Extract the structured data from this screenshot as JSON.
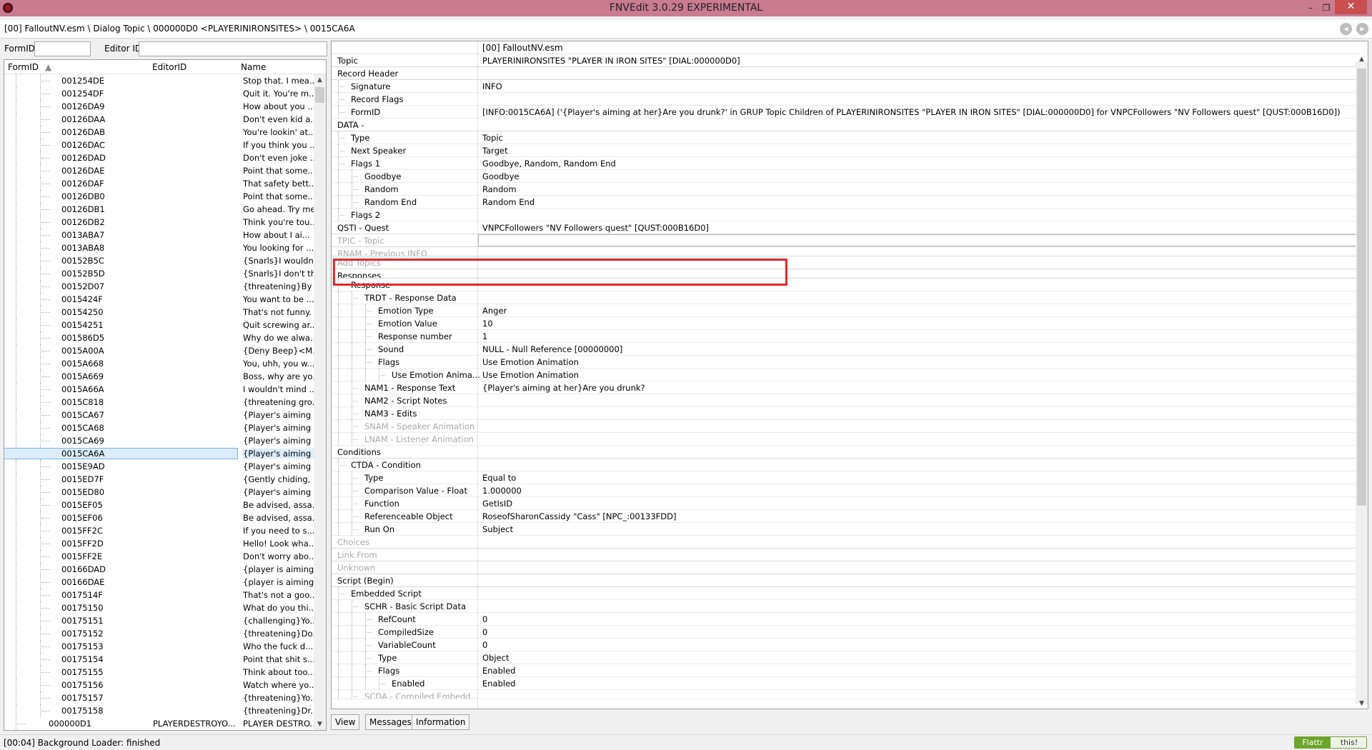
{
  "window": {
    "title": "FNVEdit 3.0.29 EXPERIMENTAL",
    "minimize": "–",
    "maximize": "❐",
    "close": "✕"
  },
  "path": {
    "text": "[00] FalloutNV.esm \\ Dialog Topic \\ 000000D0 <PLAYERINIRONSITES> \\ 0015CA6A",
    "back_icon": "◂",
    "forward_icon": "▸"
  },
  "filter": {
    "formid_label": "FormID",
    "editorid_label": "Editor ID",
    "formid_value": "",
    "editorid_value": ""
  },
  "tree": {
    "col_formid": "FormID",
    "col_editorid": "EditorID",
    "col_name": "Name",
    "rows": [
      {
        "fid": "001254DE",
        "editor": "",
        "name": "Stop that. I mea...",
        "indent": 2
      },
      {
        "fid": "001254DF",
        "editor": "",
        "name": "Quit it. You're m...",
        "indent": 2
      },
      {
        "fid": "00126DA9",
        "editor": "",
        "name": "How about you ...",
        "indent": 2
      },
      {
        "fid": "00126DAA",
        "editor": "",
        "name": "Don't even kid a...",
        "indent": 2
      },
      {
        "fid": "00126DAB",
        "editor": "",
        "name": "You're lookin' at...",
        "indent": 2
      },
      {
        "fid": "00126DAC",
        "editor": "",
        "name": "If you think you ...",
        "indent": 2
      },
      {
        "fid": "00126DAD",
        "editor": "",
        "name": "Don't even joke ...",
        "indent": 2
      },
      {
        "fid": "00126DAE",
        "editor": "",
        "name": "Point that some...",
        "indent": 2
      },
      {
        "fid": "00126DAF",
        "editor": "",
        "name": "That safety bett...",
        "indent": 2
      },
      {
        "fid": "00126DB0",
        "editor": "",
        "name": "Point that some...",
        "indent": 2
      },
      {
        "fid": "00126DB1",
        "editor": "",
        "name": "Go ahead. Try me.",
        "indent": 2
      },
      {
        "fid": "00126DB2",
        "editor": "",
        "name": "Think you're tou...",
        "indent": 2
      },
      {
        "fid": "0013ABA7",
        "editor": "",
        "name": "How about I ai...",
        "indent": 2
      },
      {
        "fid": "0013ABA8",
        "editor": "",
        "name": "You looking for ...",
        "indent": 2
      },
      {
        "fid": "00152B5C",
        "editor": "",
        "name": "{Snarls}I wouldn't.",
        "indent": 2
      },
      {
        "fid": "00152B5D",
        "editor": "",
        "name": "{Snarls}I don't th...",
        "indent": 2
      },
      {
        "fid": "00152D07",
        "editor": "",
        "name": "{threatening}By ...",
        "indent": 2
      },
      {
        "fid": "0015424F",
        "editor": "",
        "name": "You want to be ...",
        "indent": 2
      },
      {
        "fid": "00154250",
        "editor": "",
        "name": "That's not funny.",
        "indent": 2
      },
      {
        "fid": "00154251",
        "editor": "",
        "name": "Quit screwing ar...",
        "indent": 2
      },
      {
        "fid": "001586D5",
        "editor": "",
        "name": "Why do we alwa...",
        "indent": 2
      },
      {
        "fid": "0015A00A",
        "editor": "",
        "name": "{Deny Beep}<M...",
        "indent": 2
      },
      {
        "fid": "0015A668",
        "editor": "",
        "name": "You, uhh, you w...",
        "indent": 2
      },
      {
        "fid": "0015A669",
        "editor": "",
        "name": "Boss, why are yo...",
        "indent": 2
      },
      {
        "fid": "0015A66A",
        "editor": "",
        "name": "I wouldn't mind ...",
        "indent": 2
      },
      {
        "fid": "0015C818",
        "editor": "",
        "name": "{threatening gro...",
        "indent": 2
      },
      {
        "fid": "0015CA67",
        "editor": "",
        "name": "{Player's aiming ...",
        "indent": 2
      },
      {
        "fid": "0015CA68",
        "editor": "",
        "name": "{Player's aiming ...",
        "indent": 2
      },
      {
        "fid": "0015CA69",
        "editor": "",
        "name": "{Player's aiming ...",
        "indent": 2
      },
      {
        "fid": "0015CA6A",
        "editor": "",
        "name": "{Player's aiming ...",
        "indent": 2,
        "selected": true
      },
      {
        "fid": "0015E9AD",
        "editor": "",
        "name": "{Player's aiming ...",
        "indent": 2
      },
      {
        "fid": "0015ED7F",
        "editor": "",
        "name": "{Gently chiding, ...",
        "indent": 2
      },
      {
        "fid": "0015ED80",
        "editor": "",
        "name": "{Player's aiming ...",
        "indent": 2
      },
      {
        "fid": "0015EF05",
        "editor": "",
        "name": "Be advised, assa...",
        "indent": 2
      },
      {
        "fid": "0015EF06",
        "editor": "",
        "name": "Be advised, assa...",
        "indent": 2
      },
      {
        "fid": "0015FF2C",
        "editor": "",
        "name": "If you need to s...",
        "indent": 2
      },
      {
        "fid": "0015FF2D",
        "editor": "",
        "name": "Hello! Look wha...",
        "indent": 2
      },
      {
        "fid": "0015FF2E",
        "editor": "",
        "name": "Don't worry abo...",
        "indent": 2
      },
      {
        "fid": "00166DAD",
        "editor": "",
        "name": "{player is aiming...",
        "indent": 2
      },
      {
        "fid": "00166DAE",
        "editor": "",
        "name": "{player is aiming...",
        "indent": 2
      },
      {
        "fid": "0017514F",
        "editor": "",
        "name": "That's not a goo...",
        "indent": 2
      },
      {
        "fid": "00175150",
        "editor": "",
        "name": "What do you thi...",
        "indent": 2
      },
      {
        "fid": "00175151",
        "editor": "",
        "name": "{challenging}Yo...",
        "indent": 2
      },
      {
        "fid": "00175152",
        "editor": "",
        "name": "{threatening}Do...",
        "indent": 2
      },
      {
        "fid": "00175153",
        "editor": "",
        "name": "Who the fuck d...",
        "indent": 2
      },
      {
        "fid": "00175154",
        "editor": "",
        "name": "Point that shit s...",
        "indent": 2
      },
      {
        "fid": "00175155",
        "editor": "",
        "name": "Think about too...",
        "indent": 2
      },
      {
        "fid": "00175156",
        "editor": "",
        "name": "Watch where yo...",
        "indent": 2
      },
      {
        "fid": "00175157",
        "editor": "",
        "name": "{threatening}Yo...",
        "indent": 2
      },
      {
        "fid": "00175158",
        "editor": "",
        "name": "{threatening}Dr...",
        "indent": 2
      },
      {
        "fid": "000000D1",
        "editor": "PLAYERDESTROYO...",
        "name": "PLAYER DESTRO...",
        "indent": 1
      }
    ]
  },
  "records": {
    "header_value": "[00] FalloutNV.esm",
    "rows": [
      {
        "k": "Topic",
        "v": "PLAYERINIRONSITES \"PLAYER IN IRON SITES\" [DIAL:000000D0]",
        "d": 0
      },
      {
        "k": "Record Header",
        "v": "",
        "d": 0
      },
      {
        "k": "Signature",
        "v": "INFO",
        "d": 1
      },
      {
        "k": "Record Flags",
        "v": "",
        "d": 1
      },
      {
        "k": "FormID",
        "v": "[INFO:0015CA6A] ('{Player's aiming at her}Are you drunk?' in GRUP Topic Children of PLAYERINIRONSITES \"PLAYER IN IRON SITES\" [DIAL:000000D0] for VNPCFollowers \"NV Followers quest\" [QUST:000B16D0])",
        "d": 1
      },
      {
        "k": "DATA -",
        "v": "",
        "d": 0
      },
      {
        "k": "Type",
        "v": "Topic",
        "d": 1
      },
      {
        "k": "Next Speaker",
        "v": "Target",
        "d": 1
      },
      {
        "k": "Flags 1",
        "v": "Goodbye, Random, Random End",
        "d": 1
      },
      {
        "k": "Goodbye",
        "v": "Goodbye",
        "d": 2
      },
      {
        "k": "Random",
        "v": "Random",
        "d": 2
      },
      {
        "k": "Random End",
        "v": "Random End",
        "d": 2
      },
      {
        "k": "Flags 2",
        "v": "",
        "d": 1
      },
      {
        "k": "QSTI - Quest",
        "v": "VNPCFollowers \"NV Followers quest\" [QUST:000B16D0]",
        "d": 0
      },
      {
        "k": "TPIC - Topic",
        "v": "",
        "d": 0,
        "disabled": true,
        "editing": true
      },
      {
        "k": "RNAM - Previous INFO",
        "v": "",
        "d": 0,
        "disabled": true,
        "clipped": true
      },
      {
        "k": "Add Topics",
        "v": "",
        "d": 0,
        "disabled": true
      },
      {
        "k": "Responses",
        "v": "",
        "d": 0,
        "clipped": true
      },
      {
        "k": "Response",
        "v": "",
        "d": 1
      },
      {
        "k": "TRDT - Response Data",
        "v": "",
        "d": 2
      },
      {
        "k": "Emotion Type",
        "v": "Anger",
        "d": 3
      },
      {
        "k": "Emotion Value",
        "v": "10",
        "d": 3
      },
      {
        "k": "Response number",
        "v": "1",
        "d": 3
      },
      {
        "k": "Sound",
        "v": "NULL - Null Reference [00000000]",
        "d": 3
      },
      {
        "k": "Flags",
        "v": "Use Emotion Animation",
        "d": 3
      },
      {
        "k": "Use Emotion Anima...",
        "v": "Use Emotion Animation",
        "d": 4
      },
      {
        "k": "NAM1 - Response Text",
        "v": "{Player's aiming at her}Are you drunk?",
        "d": 2
      },
      {
        "k": "NAM2 - Script Notes",
        "v": "",
        "d": 2
      },
      {
        "k": "NAM3 - Edits",
        "v": "",
        "d": 2
      },
      {
        "k": "SNAM - Speaker Animation",
        "v": "",
        "d": 2,
        "disabled": true
      },
      {
        "k": "LNAM - Listener Animation",
        "v": "",
        "d": 2,
        "disabled": true
      },
      {
        "k": "Conditions",
        "v": "",
        "d": 0
      },
      {
        "k": "CTDA - Condition",
        "v": "",
        "d": 1
      },
      {
        "k": "Type",
        "v": "Equal to",
        "d": 2
      },
      {
        "k": "Comparison Value - Float",
        "v": "1.000000",
        "d": 2
      },
      {
        "k": "Function",
        "v": "GetIsID",
        "d": 2
      },
      {
        "k": "Referenceable Object",
        "v": "RoseofSharonCassidy \"Cass\" [NPC_:00133FDD]",
        "d": 2
      },
      {
        "k": "Run On",
        "v": "Subject",
        "d": 2
      },
      {
        "k": "Choices",
        "v": "",
        "d": 0,
        "disabled": true
      },
      {
        "k": "Link From",
        "v": "",
        "d": 0,
        "disabled": true
      },
      {
        "k": "Unknown",
        "v": "",
        "d": 0,
        "disabled": true
      },
      {
        "k": "Script (Begin)",
        "v": "",
        "d": 0
      },
      {
        "k": "Embedded Script",
        "v": "",
        "d": 1
      },
      {
        "k": "SCHR - Basic Script Data",
        "v": "",
        "d": 2
      },
      {
        "k": "RefCount",
        "v": "0",
        "d": 3
      },
      {
        "k": "CompiledSize",
        "v": "0",
        "d": 3
      },
      {
        "k": "VariableCount",
        "v": "0",
        "d": 3
      },
      {
        "k": "Type",
        "v": "Object",
        "d": 3
      },
      {
        "k": "Flags",
        "v": "Enabled",
        "d": 3
      },
      {
        "k": "Enabled",
        "v": "Enabled",
        "d": 4
      },
      {
        "k": "SCDA - Compiled Embedd...",
        "v": "",
        "d": 2,
        "disabled": true,
        "clipped": true
      }
    ]
  },
  "tabs": [
    {
      "label": "View",
      "active": true
    },
    {
      "label": "Messages",
      "active": false
    },
    {
      "label": "Information",
      "active": false
    }
  ],
  "status": {
    "text": "[00:04] Background Loader: finished",
    "flattr_left": "Flattr",
    "flattr_right": "this!"
  },
  "colors": {
    "titlebar": "#c97b90",
    "close": "#c7504f",
    "highlight": "#e2262b",
    "selection": "#dcecfc"
  }
}
